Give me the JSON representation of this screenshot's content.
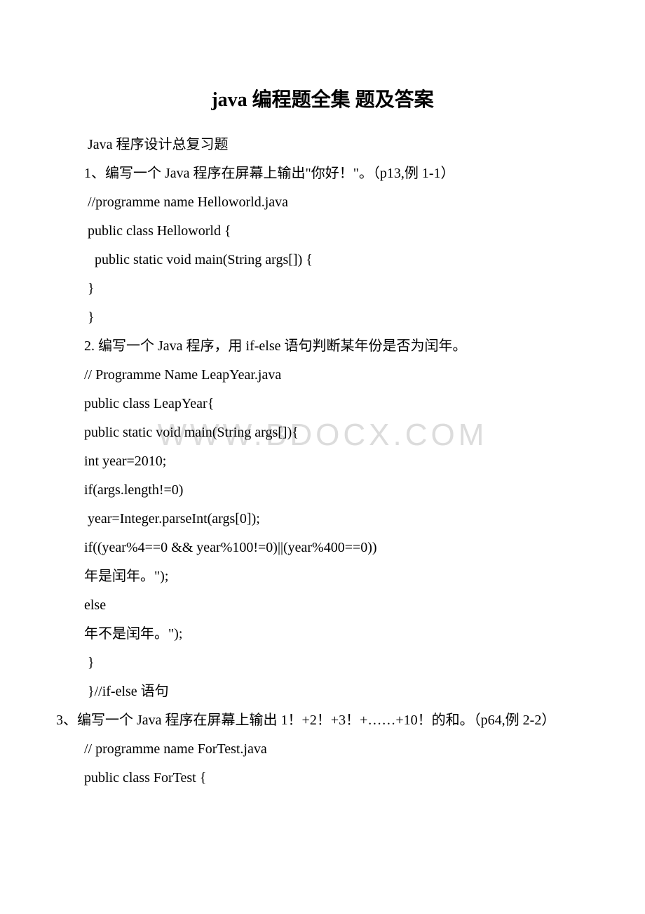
{
  "title": "java 编程题全集 题及答案",
  "watermark": "WWW.BDOCX.COM",
  "lines": [
    " Java 程序设计总复习题",
    "1、编写一个 Java 程序在屏幕上输出\"你好！\"。（p13,例 1-1）",
    " //programme name Helloworld.java",
    " public class Helloworld {",
    "   public static void main(String args[]) {",
    " }",
    " }",
    "2. 编写一个 Java 程序，用 if-else 语句判断某年份是否为闰年。",
    "// Programme Name LeapYear.java",
    "public class LeapYear{",
    "public static void main(String args[]){",
    "int year=2010;",
    "if(args.length!=0)",
    " year=Integer.parseInt(args[0]);",
    "if((year%4==0 && year%100!=0)||(year%400==0))",
    "年是闰年。\");",
    "else",
    "年不是闰年。\");",
    " }",
    " }//if-else 语句",
    "3、编写一个 Java 程序在屏幕上输出 1！+2！+3！+……+10！的和。（p64,例 2-2）",
    "// programme name ForTest.java",
    "public class ForTest {"
  ],
  "lineIndents": [
    true,
    true,
    true,
    true,
    true,
    true,
    true,
    true,
    true,
    true,
    true,
    true,
    true,
    true,
    true,
    true,
    true,
    true,
    true,
    true,
    false,
    true,
    true
  ]
}
